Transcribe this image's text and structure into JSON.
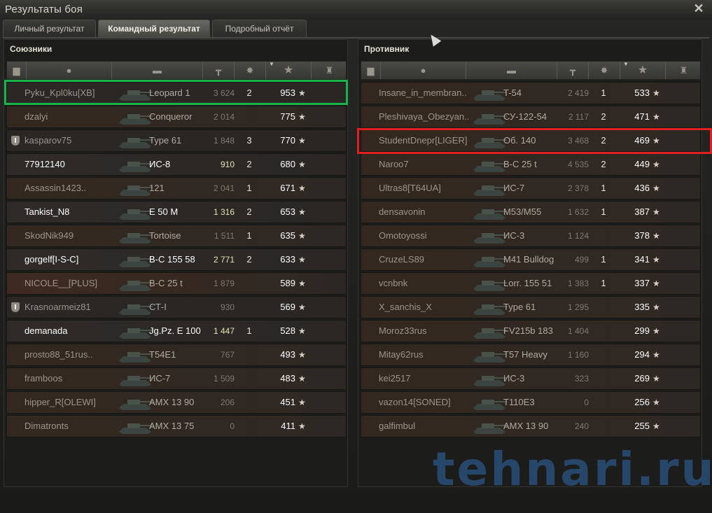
{
  "window": {
    "title": "Результаты боя"
  },
  "tabs": [
    {
      "label": "Личный результат",
      "active": false
    },
    {
      "label": "Командный результат",
      "active": true
    },
    {
      "label": "Подробный отчёт",
      "active": false
    }
  ],
  "allies": {
    "title": "Союзники",
    "rows": [
      {
        "name": "Pyku_Kpl0ku[XB]",
        "tank": "Leopard 1",
        "damage": "3 624",
        "kills": "2",
        "xp": "953",
        "alive": false,
        "badge": false,
        "style": "dead"
      },
      {
        "name": "dzalyi",
        "tank": "Conqueror",
        "damage": "2 014",
        "kills": "",
        "xp": "775",
        "alive": false,
        "badge": false,
        "style": "reddish"
      },
      {
        "name": "kasparov75",
        "tank": "Type 61",
        "damage": "1 848",
        "kills": "3",
        "xp": "770",
        "alive": false,
        "badge": true,
        "style": "dead"
      },
      {
        "name": "77912140",
        "tank": "ИС-8",
        "damage": "910",
        "kills": "2",
        "xp": "680",
        "alive": true,
        "badge": false,
        "style": "alive"
      },
      {
        "name": "Assassin1423..",
        "tank": "121",
        "damage": "2 041",
        "kills": "1",
        "xp": "671",
        "alive": false,
        "badge": false,
        "style": "reddish"
      },
      {
        "name": "Tankist_N8",
        "tank": "E 50 M",
        "damage": "1 316",
        "kills": "2",
        "xp": "653",
        "alive": true,
        "badge": false,
        "style": "alive"
      },
      {
        "name": "SkodNik949",
        "tank": "Tortoise",
        "damage": "1 511",
        "kills": "1",
        "xp": "635",
        "alive": false,
        "badge": false,
        "style": "reddish"
      },
      {
        "name": "gorgelf[I-S-C]",
        "tank": "В-С 155 58",
        "damage": "2 771",
        "kills": "2",
        "xp": "633",
        "alive": true,
        "badge": false,
        "style": "alive"
      },
      {
        "name": "NICOLE__[PLUS]",
        "tank": "В-С 25 t",
        "damage": "1 879",
        "kills": "",
        "xp": "589",
        "alive": false,
        "badge": false,
        "style": "orange"
      },
      {
        "name": "Krasnoarmeiz81",
        "tank": "СТ-I",
        "damage": "930",
        "kills": "",
        "xp": "569",
        "alive": false,
        "badge": true,
        "style": "dead"
      },
      {
        "name": "demanada",
        "tank": "Jg.Pz. E 100",
        "damage": "1 447",
        "kills": "1",
        "xp": "528",
        "alive": true,
        "badge": false,
        "style": "alive"
      },
      {
        "name": "prosto88_51rus..",
        "tank": "T54E1",
        "damage": "767",
        "kills": "",
        "xp": "493",
        "alive": false,
        "badge": false,
        "style": "reddish"
      },
      {
        "name": "framboos",
        "tank": "ИС-7",
        "damage": "1 509",
        "kills": "",
        "xp": "483",
        "alive": false,
        "badge": false,
        "style": "reddish"
      },
      {
        "name": "hipper_R[OLEWI]",
        "tank": "AMX 13 90",
        "damage": "206",
        "kills": "",
        "xp": "451",
        "alive": false,
        "badge": false,
        "style": "reddish"
      },
      {
        "name": "Dimatronts",
        "tank": "AMX 13 75",
        "damage": "0",
        "kills": "",
        "xp": "411",
        "alive": false,
        "badge": false,
        "style": "reddish"
      }
    ]
  },
  "enemies": {
    "title": "Противник",
    "rows": [
      {
        "name": "Insane_in_membran..",
        "tank": "T-54",
        "damage": "2 419",
        "kills": "1",
        "xp": "533",
        "alive": false,
        "badge": false,
        "style": "reddish"
      },
      {
        "name": "Pleshivaya_Obezyan..",
        "tank": "СУ-122-54",
        "damage": "2 117",
        "kills": "2",
        "xp": "471",
        "alive": false,
        "badge": false,
        "style": "reddish"
      },
      {
        "name": "StudentDnepr[LIGER]",
        "tank": "Об. 140",
        "damage": "3 468",
        "kills": "2",
        "xp": "469",
        "alive": false,
        "badge": false,
        "style": "reddish"
      },
      {
        "name": "Naroo7",
        "tank": "B-C 25 t",
        "damage": "4 535",
        "kills": "2",
        "xp": "449",
        "alive": false,
        "badge": false,
        "style": "reddish"
      },
      {
        "name": "Ultras8[T64UA]",
        "tank": "ИС-7",
        "damage": "2 378",
        "kills": "1",
        "xp": "436",
        "alive": false,
        "badge": false,
        "style": "reddish"
      },
      {
        "name": "densavonin",
        "tank": "M53/M55",
        "damage": "1 632",
        "kills": "1",
        "xp": "387",
        "alive": false,
        "badge": false,
        "style": "reddish"
      },
      {
        "name": "Omotoyossi",
        "tank": "ИС-3",
        "damage": "1 124",
        "kills": "",
        "xp": "378",
        "alive": false,
        "badge": false,
        "style": "reddish"
      },
      {
        "name": "CruzeLS89",
        "tank": "M41 Bulldog",
        "damage": "499",
        "kills": "1",
        "xp": "341",
        "alive": false,
        "badge": false,
        "style": "reddish"
      },
      {
        "name": "vcnbnk",
        "tank": "Lorr. 155 51",
        "damage": "1 383",
        "kills": "1",
        "xp": "337",
        "alive": false,
        "badge": false,
        "style": "reddish"
      },
      {
        "name": "X_sanchis_X",
        "tank": "Type 61",
        "damage": "1 295",
        "kills": "",
        "xp": "335",
        "alive": false,
        "badge": false,
        "style": "reddish"
      },
      {
        "name": "Moroz33rus",
        "tank": "FV215b 183",
        "damage": "1 404",
        "kills": "",
        "xp": "299",
        "alive": false,
        "badge": false,
        "style": "reddish"
      },
      {
        "name": "Mitay62rus",
        "tank": "T57 Heavy",
        "damage": "1 160",
        "kills": "",
        "xp": "294",
        "alive": false,
        "badge": false,
        "style": "reddish"
      },
      {
        "name": "kei2517",
        "tank": "ИС-3",
        "damage": "323",
        "kills": "",
        "xp": "269",
        "alive": false,
        "badge": false,
        "style": "reddish"
      },
      {
        "name": "vazon14[SONED]",
        "tank": "T110E3",
        "damage": "0",
        "kills": "",
        "xp": "256",
        "alive": false,
        "badge": false,
        "style": "reddish"
      },
      {
        "name": "galfimbul",
        "tank": "AMX 13 90",
        "damage": "240",
        "kills": "",
        "xp": "255",
        "alive": false,
        "badge": false,
        "style": "reddish"
      }
    ]
  },
  "header_icons": [
    "badge-column-icon",
    "player-column-icon",
    "tank-column-icon",
    "damage-column-icon",
    "kills-column-icon",
    "xp-column-icon",
    "medal-column-icon"
  ],
  "watermark": "tehnari.ru"
}
